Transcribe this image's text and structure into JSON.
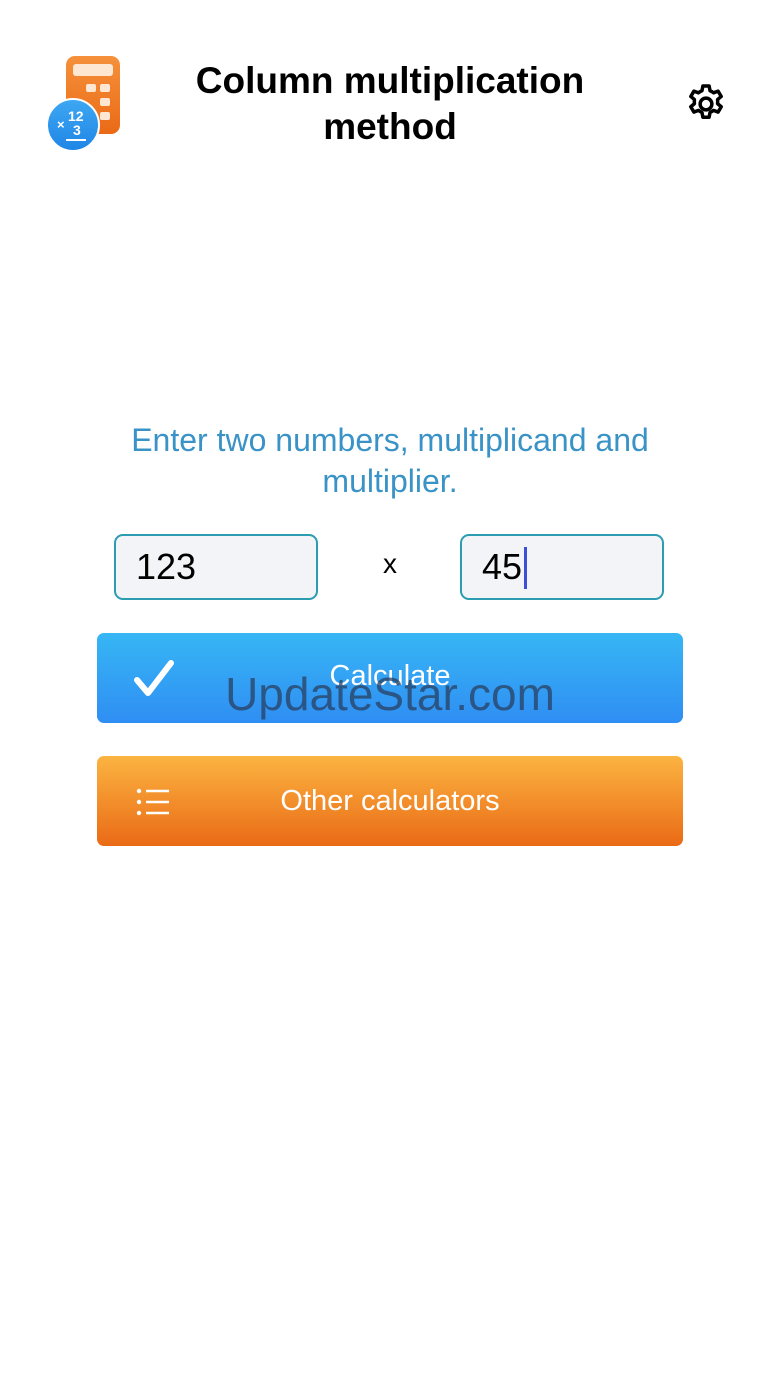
{
  "header": {
    "title": "Column multiplication method",
    "app_icon": "calculator-badge-icon",
    "settings_icon": "gear-icon"
  },
  "prompt": "Enter two numbers, multiplicand and multiplier.",
  "inputs": {
    "multiplicand": "123",
    "operator": "x",
    "multiplier": "45"
  },
  "buttons": {
    "calculate": {
      "label": "Calculate",
      "icon": "checkmark-icon",
      "color": "#2f8ef3"
    },
    "other": {
      "label": "Other calculators",
      "icon": "list-icon",
      "color": "#ea6a16"
    }
  },
  "watermark": "UpdateStar.com"
}
